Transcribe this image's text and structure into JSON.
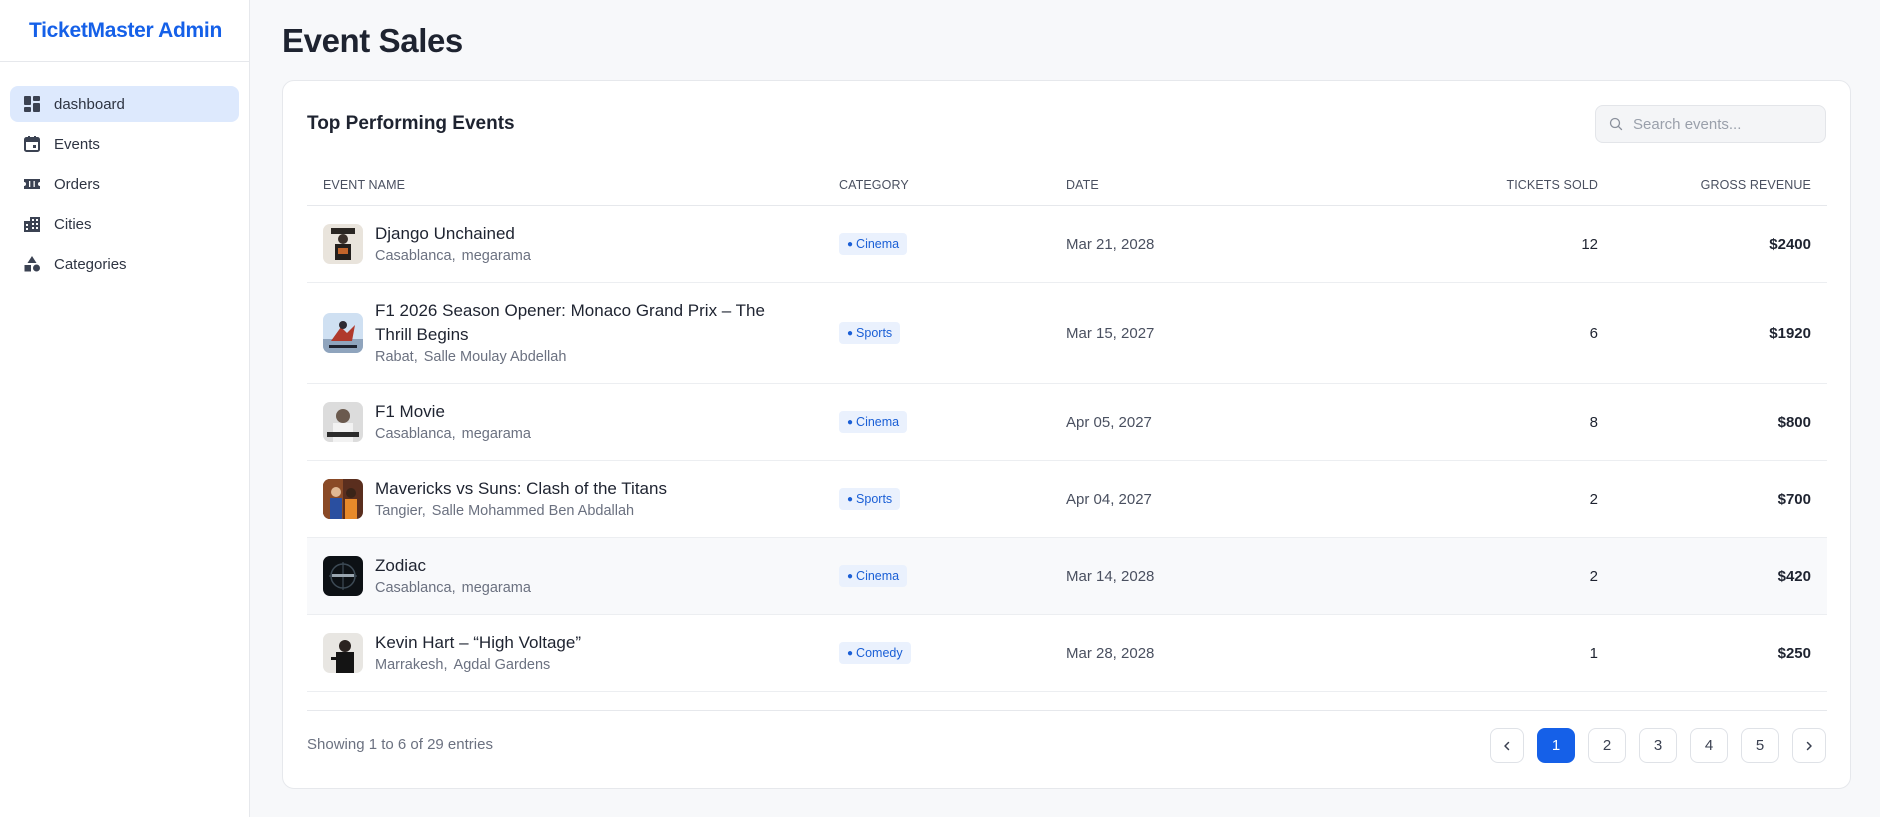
{
  "app": {
    "brand": "TicketMaster Admin"
  },
  "sidebar": {
    "items": [
      {
        "label": "dashboard",
        "icon": "dashboard-icon",
        "active": true
      },
      {
        "label": "Events",
        "icon": "calendar-icon",
        "active": false
      },
      {
        "label": "Orders",
        "icon": "ticket-icon",
        "active": false
      },
      {
        "label": "Cities",
        "icon": "city-icon",
        "active": false
      },
      {
        "label": "Categories",
        "icon": "categories-icon",
        "active": false
      }
    ]
  },
  "page": {
    "title": "Event Sales"
  },
  "card": {
    "title": "Top Performing Events",
    "search": {
      "placeholder": "Search events...",
      "value": ""
    }
  },
  "table": {
    "headers": {
      "name": "EVENT NAME",
      "category": "CATEGORY",
      "date": "DATE",
      "tickets": "TICKETS SOLD",
      "revenue": "GROSS REVENUE"
    },
    "rows": [
      {
        "title": "Django Unchained",
        "city": "Casablanca,",
        "venue": "megarama",
        "category": "Cinema",
        "date": "Mar 21, 2028",
        "tickets": "12",
        "revenue": "$2400",
        "thumb": "django-poster"
      },
      {
        "title": "F1 2026 Season Opener: Monaco Grand Prix – The Thrill Begins",
        "city": "Rabat,",
        "venue": "Salle Moulay Abdellah",
        "category": "Sports",
        "date": "Mar 15, 2027",
        "tickets": "6",
        "revenue": "$1920",
        "thumb": "f1-race-poster"
      },
      {
        "title": "F1 Movie",
        "city": "Casablanca,",
        "venue": "megarama",
        "category": "Cinema",
        "date": "Apr 05, 2027",
        "tickets": "8",
        "revenue": "$800",
        "thumb": "f1-movie-poster"
      },
      {
        "title": "Mavericks vs Suns: Clash of the Titans",
        "city": "Tangier,",
        "venue": "Salle Mohammed Ben Abdallah",
        "category": "Sports",
        "date": "Apr 04, 2027",
        "tickets": "2",
        "revenue": "$700",
        "thumb": "basketball-poster"
      },
      {
        "title": "Zodiac",
        "city": "Casablanca,",
        "venue": "megarama",
        "category": "Cinema",
        "date": "Mar 14, 2028",
        "tickets": "2",
        "revenue": "$420",
        "thumb": "zodiac-poster"
      },
      {
        "title": "Kevin Hart – “High Voltage”",
        "city": "Marrakesh,",
        "venue": "Agdal Gardens",
        "category": "Comedy",
        "date": "Mar 28, 2028",
        "tickets": "1",
        "revenue": "$250",
        "thumb": "comedian-poster"
      }
    ]
  },
  "footer": {
    "showing": "Showing 1 to 6 of 29 entries",
    "pages": [
      "1",
      "2",
      "3",
      "4",
      "5"
    ],
    "current_page": "1"
  },
  "colors": {
    "accent": "#1560e8",
    "badge_bg": "#eaf1fd",
    "active_nav": "#dde9fd"
  }
}
